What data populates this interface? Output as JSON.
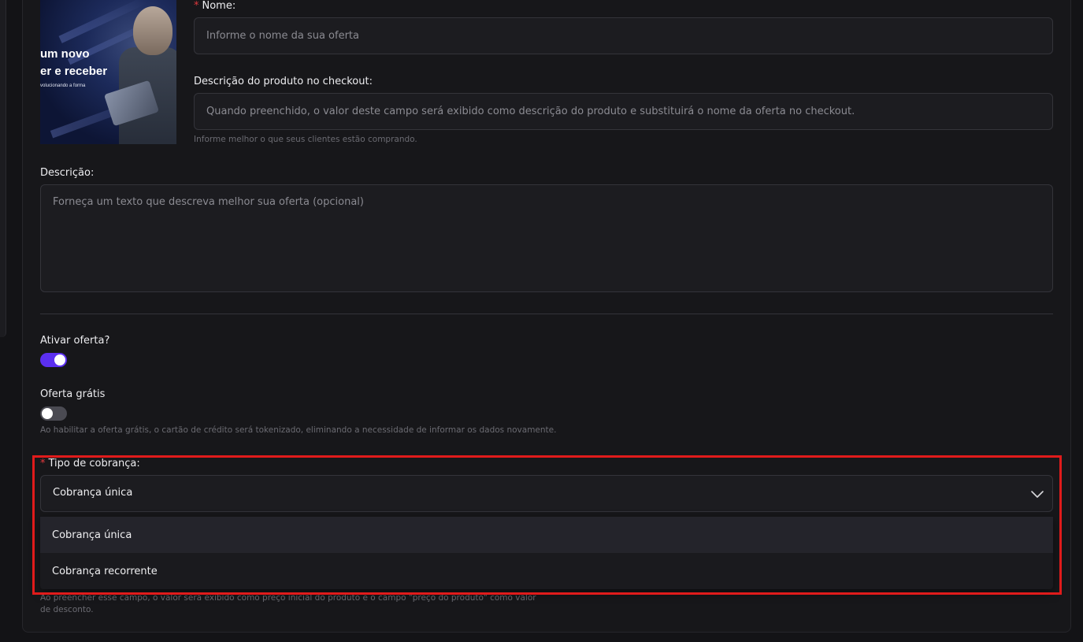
{
  "thumbnail": {
    "line1": "um novo",
    "line2": "er e receber",
    "line3": "volucionando a forma"
  },
  "name_field": {
    "required_mark": "*",
    "label": "Nome:",
    "placeholder": "Informe o nome da sua oferta"
  },
  "checkout_desc": {
    "label": "Descrição do produto no checkout:",
    "placeholder": "Quando preenchido, o valor deste campo será exibido como descrição do produto e substituirá o nome da oferta no checkout.",
    "hint": "Informe melhor o que seus clientes estão comprando."
  },
  "description": {
    "label": "Descrição:",
    "placeholder": "Forneça um texto que descreva melhor sua oferta (opcional)"
  },
  "activate_offer": {
    "label": "Ativar oferta?",
    "enabled": true
  },
  "free_offer": {
    "label": "Oferta grátis",
    "enabled": false,
    "hint": "Ao habilitar a oferta grátis, o cartão de crédito será tokenizado, eliminando a necessidade de informar os dados novamente."
  },
  "billing_type": {
    "required_mark": "*",
    "label": "Tipo de cobrança:",
    "selected": "Cobrança única",
    "options": [
      "Cobrança única",
      "Cobrança recorrente"
    ]
  },
  "price_note": "Ao preencher esse campo, o valor será exibido como preço inicial do produto e o campo \"preço do produto\" como valor de desconto.",
  "colors": {
    "accent": "#5b2ff0",
    "required": "#e0393d",
    "highlight": "#e01b1b"
  }
}
